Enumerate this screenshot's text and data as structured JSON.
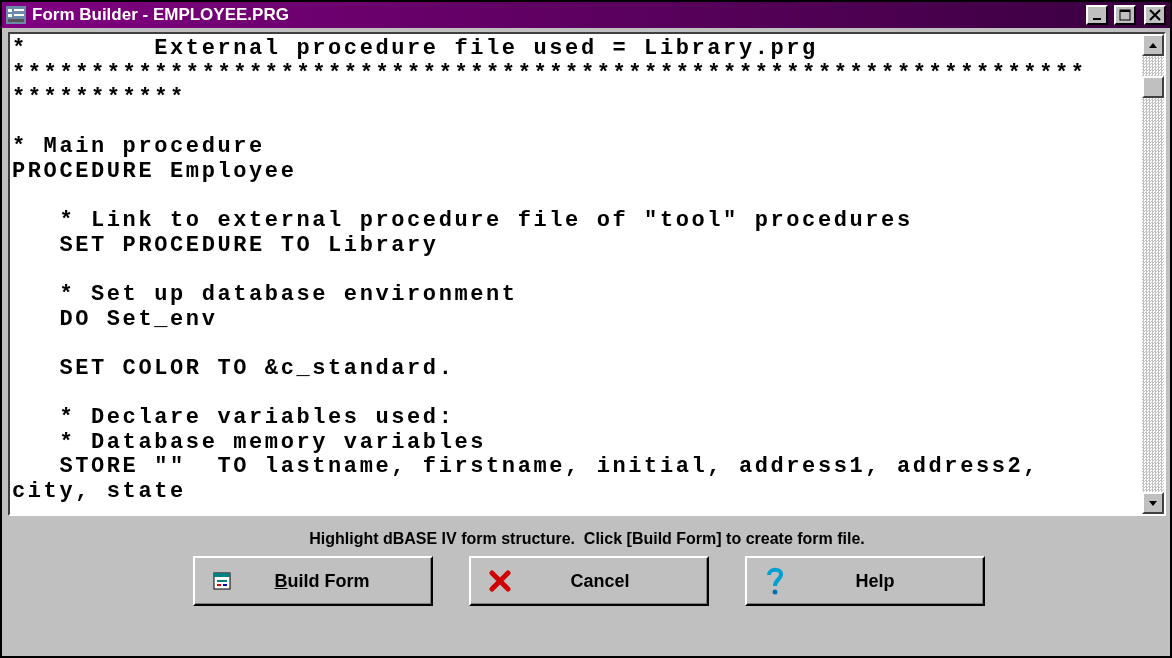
{
  "window": {
    "title": "Form Builder - EMPLOYEE.PRG"
  },
  "code_blocks": [
    [
      "*        External procedure file used = Library.prg",
      "********************************************************************",
      "***********"
    ],
    [
      "* Main procedure",
      "PROCEDURE Employee"
    ],
    [
      "   * Link to external procedure file of \"tool\" procedures",
      "   SET PROCEDURE TO Library"
    ],
    [
      "   * Set up database environment",
      "   DO Set_env"
    ],
    [
      "   SET COLOR TO &c_standard."
    ],
    [
      "   * Declare variables used:",
      "   * Database memory variables",
      "   STORE \"\"  TO lastname, firstname, initial, address1, address2,",
      "city, state"
    ]
  ],
  "hint": "Highlight dBASE IV form structure.  Click [Build Form] to create form file.",
  "buttons": [
    {
      "kind": "build",
      "label": "Build Form"
    },
    {
      "kind": "cancel",
      "label": "Cancel"
    },
    {
      "kind": "help",
      "label": "Help"
    }
  ]
}
